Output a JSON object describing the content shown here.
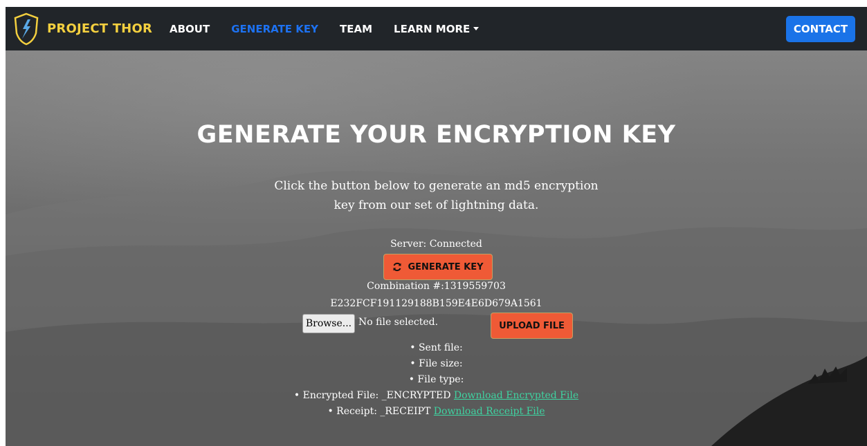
{
  "nav": {
    "brand": "PROJECT THOR",
    "links": [
      {
        "label": "ABOUT"
      },
      {
        "label": "GENERATE KEY"
      },
      {
        "label": "TEAM"
      },
      {
        "label": "LEARN MORE"
      }
    ],
    "contact": "CONTACT"
  },
  "hero": {
    "title": "GENERATE YOUR ENCRYPTION KEY",
    "intro_line1": "Click the button below to generate an md5 encryption",
    "intro_line2": "key from our set of lightning data.",
    "server_status": "Server: Connected",
    "generate_button": "GENERATE KEY",
    "combination": "Combination #:1319559703",
    "hash": "E232FCF191129188B159E4E6D679A1561"
  },
  "upload": {
    "browse_button": "Browse...",
    "file_status": "No file selected.",
    "upload_button": "UPLOAD FILE"
  },
  "results": {
    "sent_file": "Sent file:",
    "file_size": "File size:",
    "file_type": "File type:",
    "encrypted_file": "Encrypted File: _ENCRYPTED",
    "encrypted_link": "Download Encrypted File",
    "receipt": "Receipt: _RECEIPT",
    "receipt_link": "Download Receipt File"
  },
  "colors": {
    "navbar": "#212529",
    "brand": "#f4d03f",
    "active_link": "#1d72f2",
    "contact_button": "#1a73e8",
    "action_button": "#ef5a36",
    "download_link": "#3fd3a1"
  }
}
